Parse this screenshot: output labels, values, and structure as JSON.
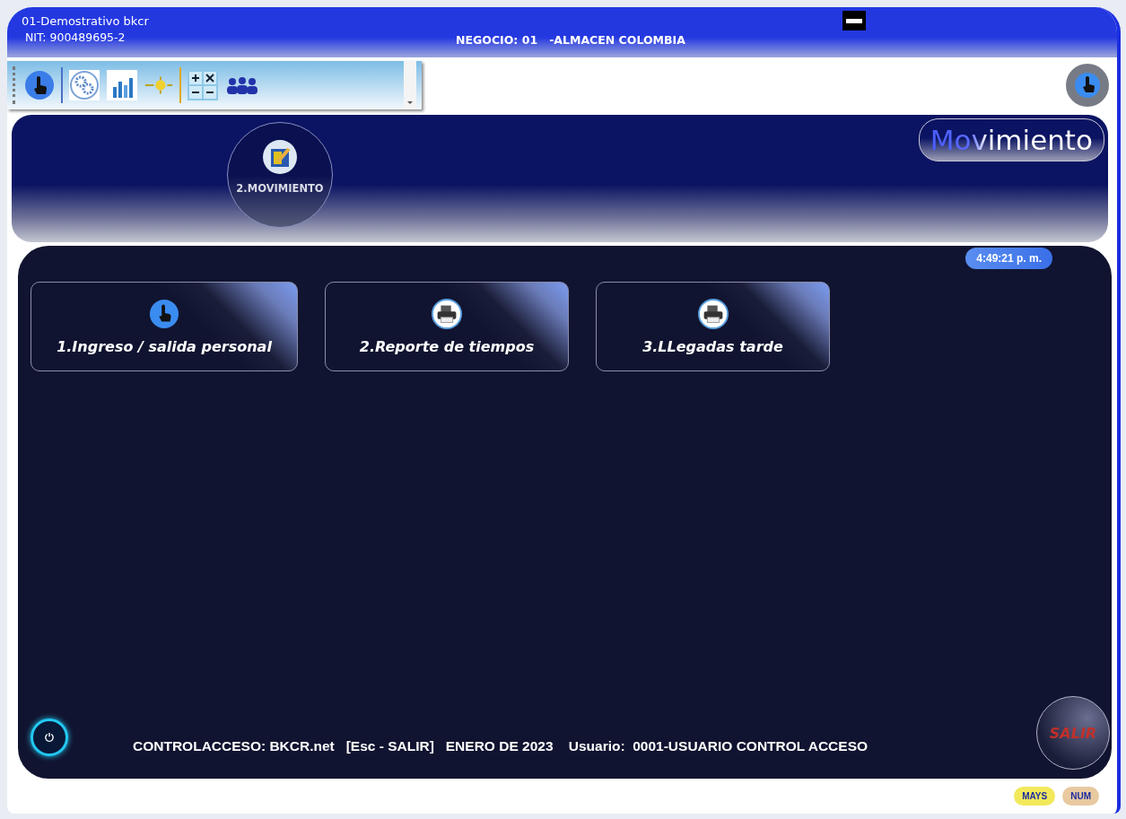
{
  "header": {
    "company": "01-Demostrativo bkcr",
    "nit": "NIT: 900489695-2",
    "business": "NEGOCIO: 01   -ALMACEN COLOMBIA"
  },
  "module": {
    "label": "2.MOVIMIENTO",
    "title": "Movimiento"
  },
  "clock": "4:49:21 p. m.",
  "options": [
    {
      "label": "1.Ingreso / salida personal",
      "kind": "touch"
    },
    {
      "label": "2.Reporte de tiempos",
      "kind": "printer"
    },
    {
      "label": "3.LLegadas tarde",
      "kind": "printer"
    }
  ],
  "footer": {
    "text": "CONTROLACCESO: BKCR.net   [Esc - SALIR]   ENERO DE 2023    Usuario:  0001-USUARIO CONTROL ACCESO",
    "exit": "SALIR"
  },
  "status": [
    {
      "label": "MAYS",
      "color": "#f2e85a"
    },
    {
      "label": "NUM",
      "color": "#e8c9a0"
    }
  ]
}
